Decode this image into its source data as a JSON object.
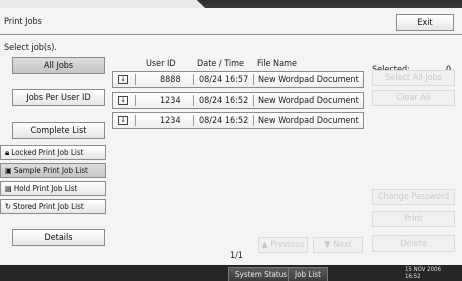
{
  "window": {
    "title": "Print Jobs",
    "exit_label": "Exit"
  },
  "sidebar": {
    "prompt": "Select job(s).",
    "all_jobs": "All Jobs",
    "jobs_per_user": "Jobs Per User ID",
    "complete_list": "Complete List",
    "locked": "Locked Print Job List",
    "sample": "Sample Print Job List",
    "hold": "Hold Print Job List",
    "stored": "Stored Print Job List",
    "details": "Details"
  },
  "table": {
    "headers": {
      "user_id": "User ID",
      "datetime": "Date / Time",
      "file_name": "File Name"
    },
    "rows": [
      {
        "user_id": "8888",
        "datetime": "08/24 16:57",
        "file_name": "New Wordpad Document"
      },
      {
        "user_id": "1234",
        "datetime": "08/24 16:52",
        "file_name": "New Wordpad Document"
      },
      {
        "user_id": "1234",
        "datetime": "08/24 16:52",
        "file_name": "New Wordpad Document"
      }
    ]
  },
  "actions": {
    "selected_label": "Selected:",
    "selected_count": "0",
    "select_all": "Select All Jobs",
    "clear_all": "Clear All",
    "change_password": "Change Password",
    "print": "Print",
    "delete": "Delete"
  },
  "pager": {
    "page": "1/1",
    "previous": "▲ Previous",
    "next": "▼ Next"
  },
  "status_bar": {
    "system_status": "System Status",
    "job_list": "Job List",
    "date": "15 NOV  2006",
    "time": "16:52"
  },
  "icons": {
    "locked": "lock-icon",
    "sample": "sample-print-icon",
    "hold": "hold-print-icon",
    "stored": "stored-print-icon",
    "row": "print-job-icon"
  },
  "colors": {
    "panel": "#f4f4f4",
    "status_bar": "#262626",
    "disabled_text": "#c9c9c9"
  }
}
